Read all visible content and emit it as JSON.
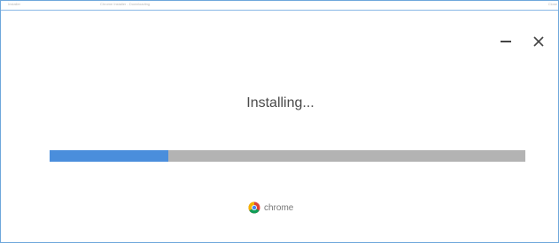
{
  "titlebar": {
    "left_text": "Installer",
    "center_text": "Chrome Installer - Downloading",
    "right_text": "Close"
  },
  "window_controls": {
    "minimize_icon": "minimize-icon",
    "close_icon": "close-icon"
  },
  "status": {
    "title": "Installing..."
  },
  "progress": {
    "fraction": 0.25,
    "fill_color": "#4a8edc",
    "track_color": "#b3b3b3"
  },
  "brand": {
    "logo_icon": "chrome-logo-icon",
    "name": "chrome"
  },
  "colors": {
    "border": "#6fa8dc",
    "text": "#4a4a4a"
  }
}
